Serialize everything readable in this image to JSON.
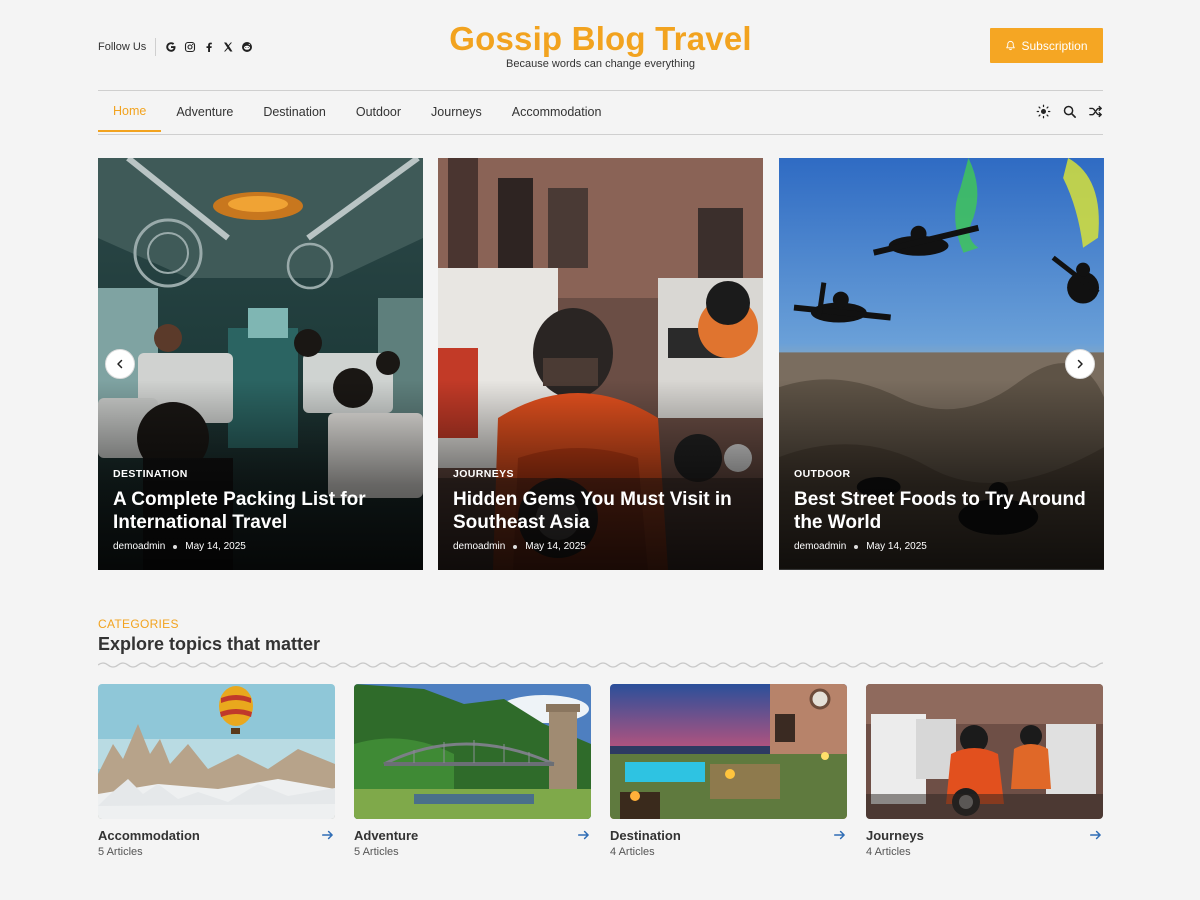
{
  "colors": {
    "accent": "#f2a31f",
    "button": "#f5a623",
    "link_arrow": "#2f6db5",
    "background": "#f4f4f4"
  },
  "header": {
    "follow_label": "Follow Us",
    "social_icons": [
      "google-icon",
      "instagram-icon",
      "facebook-icon",
      "x-icon",
      "reddit-icon"
    ],
    "title": "Gossip Blog Travel",
    "tagline": "Because words can change everything",
    "subscription_label": "Subscription"
  },
  "nav": {
    "items": [
      {
        "label": "Home",
        "active": true
      },
      {
        "label": "Adventure",
        "active": false
      },
      {
        "label": "Destination",
        "active": false
      },
      {
        "label": "Outdoor",
        "active": false
      },
      {
        "label": "Journeys",
        "active": false
      },
      {
        "label": "Accommodation",
        "active": false
      }
    ],
    "tools": [
      "theme-toggle-icon",
      "search-icon",
      "shuffle-icon"
    ]
  },
  "slider": {
    "slides": [
      {
        "category": "DESTINATION",
        "title": "A Complete Packing List for International Travel",
        "author": "demoadmin",
        "date": "May 14, 2025",
        "image": "bus-interior-photo"
      },
      {
        "category": "JOURNEYS",
        "title": "Hidden Gems You Must Visit in Southeast Asia",
        "author": "demoadmin",
        "date": "May 14, 2025",
        "image": "motorcyclist-photo"
      },
      {
        "category": "OUTDOOR",
        "title": "Best Street Foods to Try Around the World",
        "author": "demoadmin",
        "date": "May 14, 2025",
        "image": "skydivers-photo"
      }
    ]
  },
  "categories": {
    "kicker": "CATEGORIES",
    "heading": "Explore topics that matter",
    "items": [
      {
        "name": "Accommodation",
        "count": "5 Articles",
        "image": "balloon-photo"
      },
      {
        "name": "Adventure",
        "count": "5 Articles",
        "image": "bridge-photo"
      },
      {
        "name": "Destination",
        "count": "4 Articles",
        "image": "terrace-photo"
      },
      {
        "name": "Journeys",
        "count": "4 Articles",
        "image": "riders-photo"
      }
    ]
  }
}
